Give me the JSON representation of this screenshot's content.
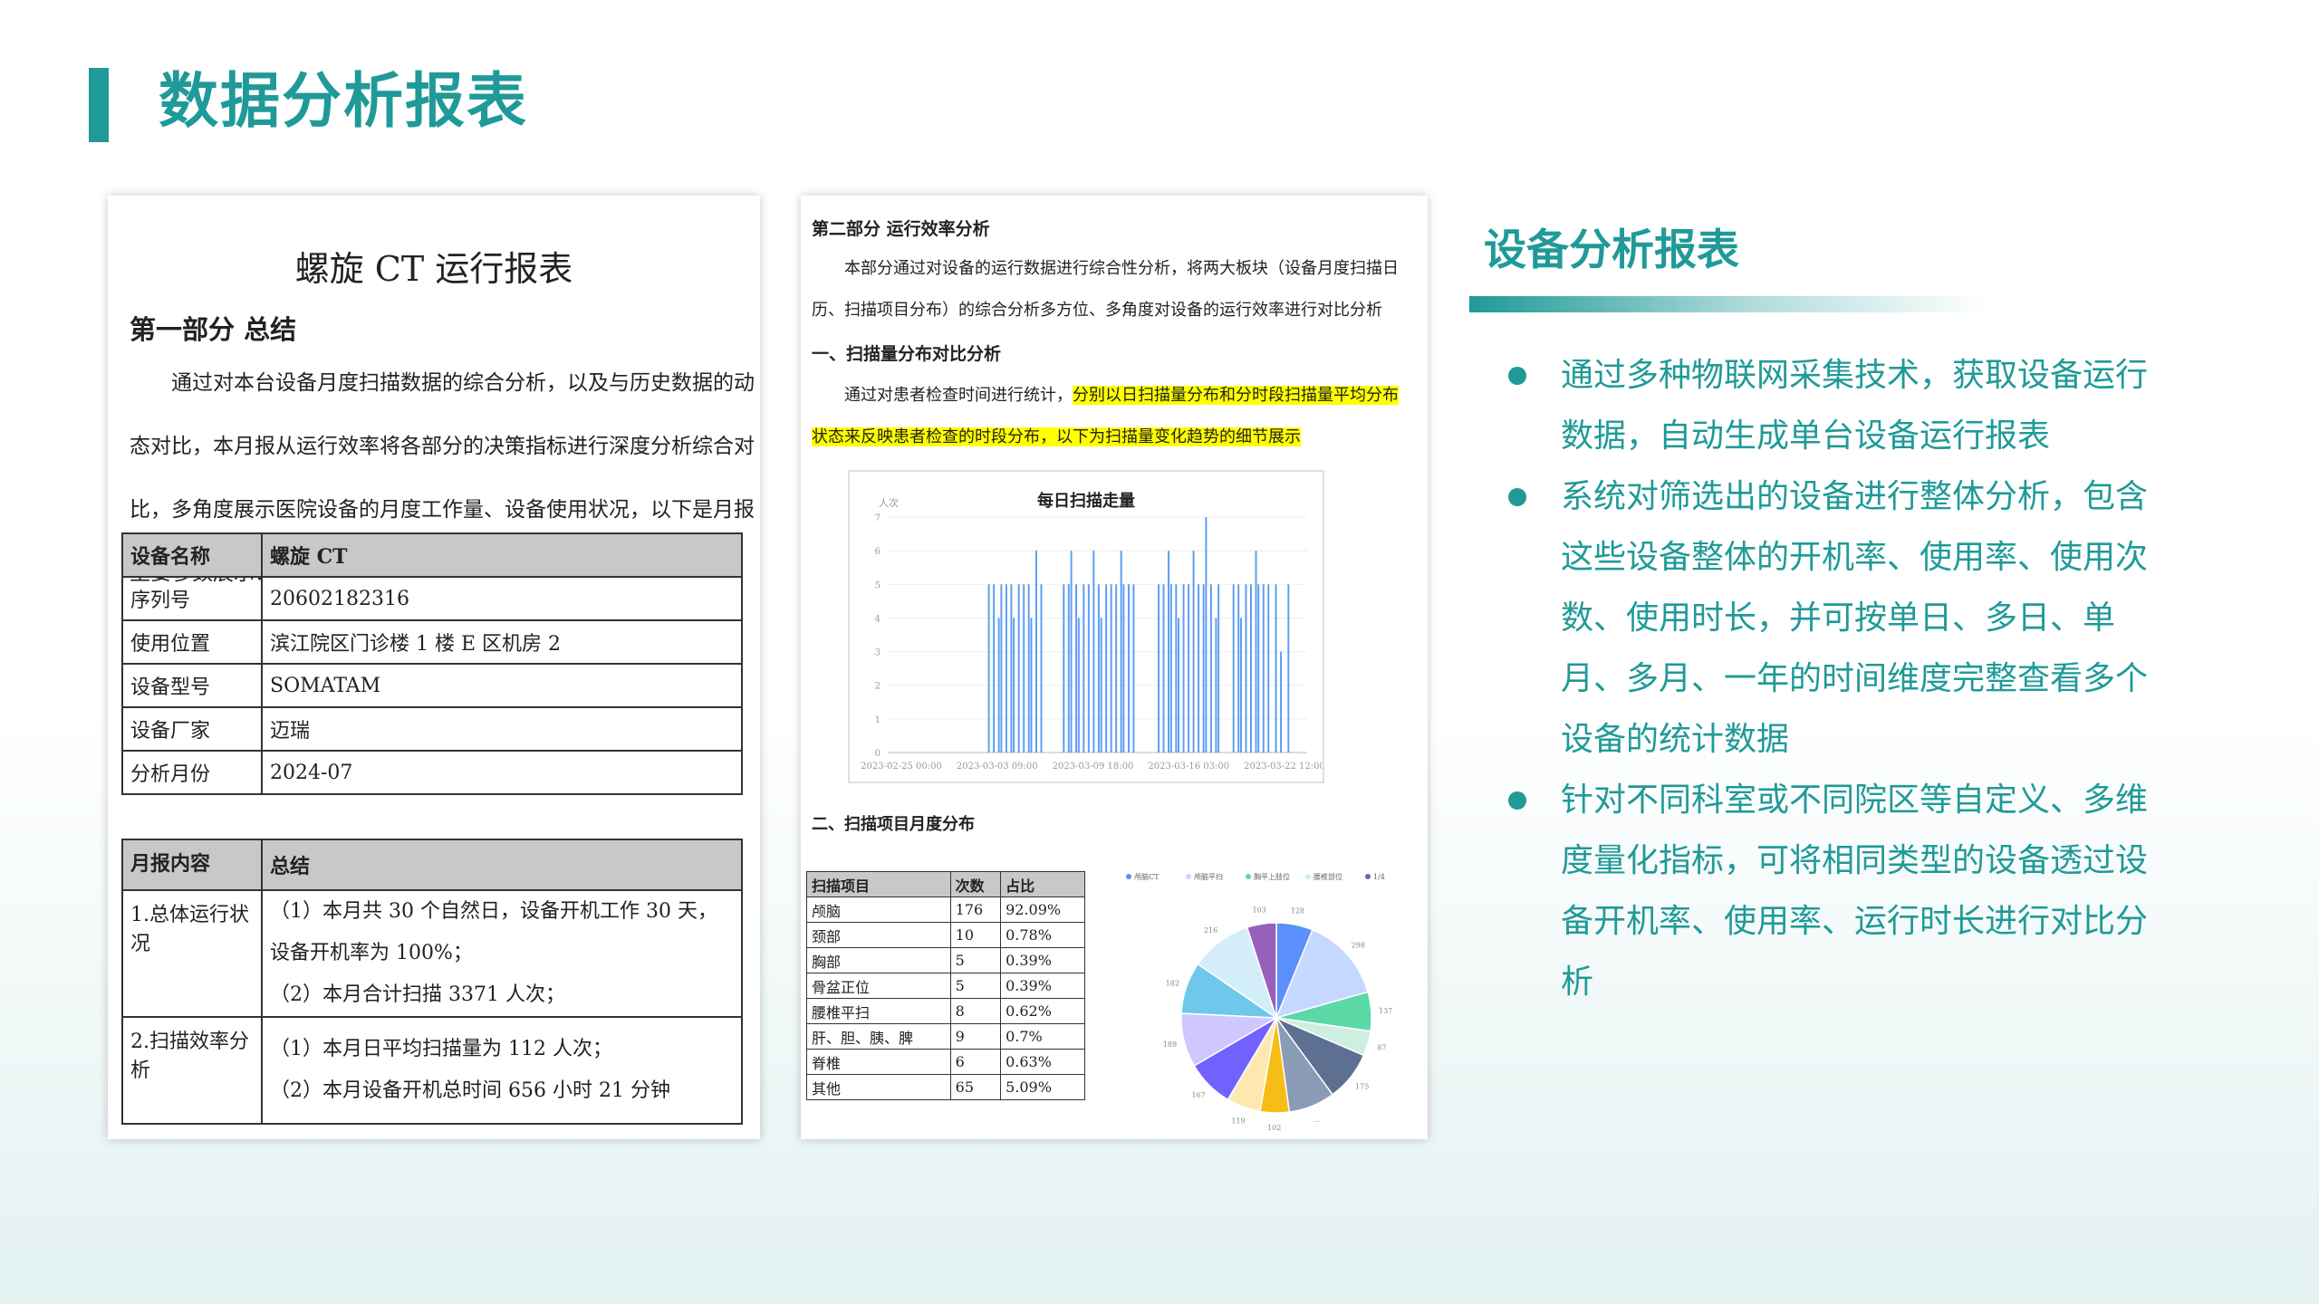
{
  "page_title": "数据分析报表",
  "doc1": {
    "title": "螺旋 CT 运行报表",
    "part": "第一部分  总结",
    "para": "通过对本台设备月度扫描数据的综合分析，以及与历史数据的动态对比，本月报从运行效率将各部分的决策指标进行深度分析综合对比，多角度展示医院设备的月度工作量、设备使用状况，以下是月报主要参数展示：",
    "info_table": [
      [
        "设备名称",
        "螺旋 CT"
      ],
      [
        "序列号",
        "20602182316"
      ],
      [
        "使用位置",
        "滨江院区门诊楼 1 楼 E 区机房 2"
      ],
      [
        "设备型号",
        "SOMATAM"
      ],
      [
        "设备厂家",
        "迈瑞"
      ],
      [
        "分析月份",
        "2024-07"
      ]
    ],
    "summary_header": [
      "月报内容",
      "总结"
    ],
    "summary_rows": [
      {
        "label": "1.总体运行状况",
        "lines": [
          "（1）本月共 30 个自然日，设备开机工作 30 天，设备开机率为 100%；",
          "（2）本月合计扫描 3371 人次；"
        ]
      },
      {
        "label": "2.扫描效率分析",
        "lines": [
          "（1）本月日平均扫描量为 112 人次；",
          "（2）本月设备开机总时间 656 小时 21 分钟"
        ]
      }
    ]
  },
  "doc2": {
    "part": "第二部分    运行效率分析",
    "intro": "本部分通过对设备的运行数据进行综合性分析，将两大板块（设备月度扫描日历、扫描项目分布）的综合分析多方位、多角度对设备的运行效率进行对比分析",
    "sub1": "一、扫描量分布对比分析",
    "sub1_text_plain": "通过对患者检查时间进行统计，",
    "sub1_text_hl": "分别以日扫描量分布和分时段扫描量平均分布状态来反映患者检查的时段分布，以下为扫描量变化趋势的细节展示",
    "sub2": "二、扫描项目月度分布",
    "scan_table_header": [
      "扫描项目",
      "次数",
      "占比"
    ],
    "scan_table": [
      [
        "颅脑",
        "176",
        "92.09%"
      ],
      [
        "颈部",
        "10",
        "0.78%"
      ],
      [
        "胸部",
        "5",
        "0.39%"
      ],
      [
        "骨盆正位",
        "5",
        "0.39%"
      ],
      [
        "腰椎平扫",
        "8",
        "0.62%"
      ],
      [
        "肝、胆、胰、脾",
        "9",
        "0.7%"
      ],
      [
        "脊椎",
        "6",
        "0.63%"
      ],
      [
        "其他",
        "65",
        "5.09%"
      ]
    ]
  },
  "chart_data": [
    {
      "type": "bar",
      "title": "每日扫描走量",
      "ylabel": "人次",
      "ylim": [
        0,
        7
      ],
      "yticks": [
        "0",
        "1",
        "2",
        "3",
        "4",
        "5",
        "6",
        "7"
      ],
      "xticks": [
        "2023-02-25 00:00",
        "2023-03-03 09:00",
        "2023-03-09 18:00",
        "2023-03-16 03:00",
        "2023-03-22 12:00"
      ],
      "values": [
        0,
        0,
        0,
        0,
        0,
        0,
        0,
        0,
        0,
        0,
        0,
        0,
        0,
        0,
        0,
        0,
        0,
        0,
        0,
        0,
        0,
        0,
        0,
        0,
        0,
        0,
        0,
        0,
        0,
        0,
        0,
        0,
        0,
        0,
        0,
        0,
        0,
        0,
        0,
        0,
        5,
        0,
        5,
        0,
        4,
        5,
        0,
        5,
        0,
        5,
        4,
        0,
        5,
        0,
        5,
        0,
        5,
        4,
        0,
        6,
        0,
        5,
        0,
        0,
        0,
        0,
        0,
        0,
        0,
        0,
        5,
        0,
        5,
        6,
        0,
        5,
        4,
        0,
        5,
        0,
        5,
        0,
        6,
        0,
        5,
        4,
        0,
        5,
        0,
        5,
        0,
        5,
        0,
        6,
        5,
        0,
        5,
        0,
        5,
        0,
        0,
        0,
        0,
        0,
        0,
        0,
        0,
        0,
        5,
        0,
        5,
        0,
        6,
        5,
        0,
        5,
        4,
        0,
        5,
        0,
        5,
        0,
        6,
        0,
        5,
        0,
        5,
        7,
        0,
        5,
        0,
        4,
        5,
        0,
        0,
        0,
        0,
        0,
        5,
        0,
        5,
        4,
        0,
        5,
        0,
        5,
        0,
        6,
        5,
        0,
        5,
        0,
        5,
        0,
        0,
        5,
        0,
        3,
        0,
        0,
        5,
        0,
        0,
        0,
        0,
        0,
        0,
        0
      ]
    },
    {
      "type": "pie",
      "legend": [
        "颅脑CT",
        "颅脑平扫",
        "胸平上肢位",
        "腰椎部位",
        "1/4"
      ],
      "values": [
        128,
        298,
        137,
        87,
        175,
        163,
        102,
        119,
        167,
        189,
        182,
        216,
        103
      ],
      "labels": [
        "128",
        "298",
        "137",
        "87",
        "175",
        "...",
        "102",
        "119",
        "167",
        "189",
        "182",
        "216",
        "103"
      ],
      "colors": [
        "#5b8ff9",
        "#c6d8ff",
        "#5ad8a6",
        "#cdeee0",
        "#5d7092",
        "#8a9bb5",
        "#f6bd16",
        "#fde9b0",
        "#7262fd",
        "#cfc8ff",
        "#6dc8ec",
        "#d3eef9",
        "#9661bc"
      ]
    }
  ],
  "right_panel": {
    "title": "设备分析报表",
    "bullets": [
      "通过多种物联网采集技术，获取设备运行数据，自动生成单台设备运行报表",
      "系统对筛选出的设备进行整体分析，包含这些设备整体的开机率、使用率、使用次数、使用时长，并可按单日、多日、单月、多月、一年的时间维度完整查看多个设备的统计数据",
      "针对不同科室或不同院区等自定义、多维度量化指标，可将相同类型的设备透过设备开机率、使用率、运行时长进行对比分析"
    ]
  },
  "colors": {
    "accent": "#1f9a98",
    "highlight": "#ffff00",
    "bar": "#5b9bf2"
  }
}
